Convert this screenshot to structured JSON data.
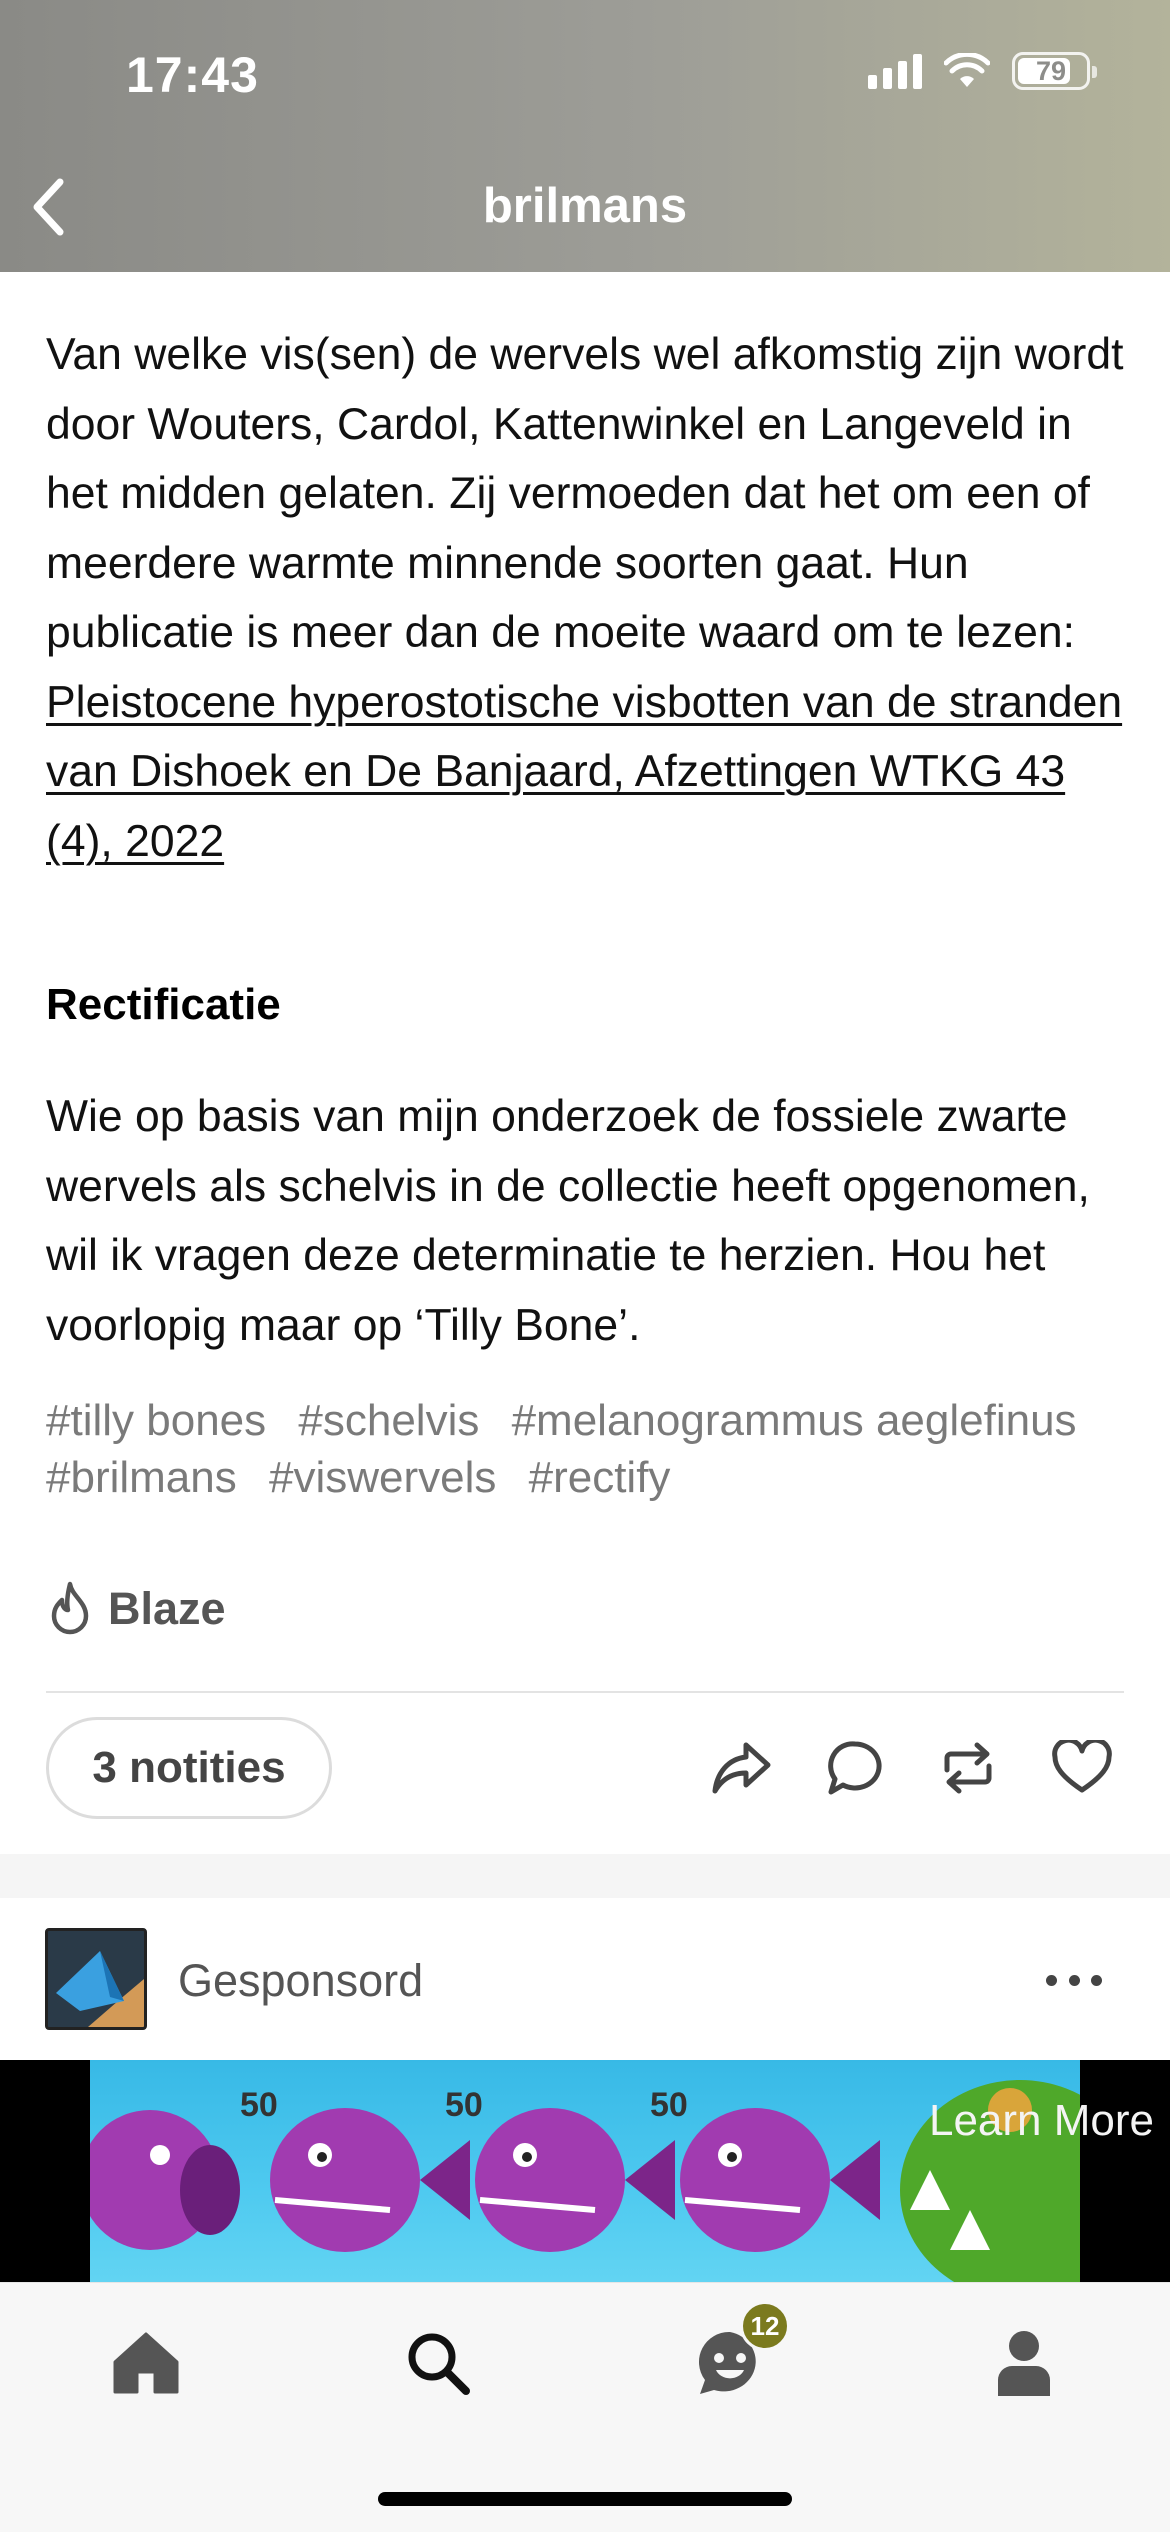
{
  "status_bar": {
    "time": "17:43",
    "battery": "79",
    "battery_level": 0.79
  },
  "header": {
    "title": "brilmans",
    "back_icon": "chevron-left-icon"
  },
  "post": {
    "paragraph1_text": "Van welke vis(sen) de wervels wel afkomstig zijn wordt door Wouters, Cardol, Kattenwinkel en Langeveld in het midden gelaten. Zij vermoeden dat het om een of meerdere warmte minnende soorten gaat. Hun publicatie is meer dan de moeite waard om te lezen:",
    "paragraph1_link": " Pleistocene hyperostotische visbotten van de stranden van Dishoek en De Banjaard, Afzettingen WTKG 43 (4), 2022",
    "heading": "Rectificatie",
    "paragraph2": "Wie op basis van mijn onderzoek de fossiele zwarte wervels als schelvis in de collectie heeft opgenomen, wil ik vragen deze determinatie te herzien. Hou het voorlopig maar op ‘Tilly Bone’.",
    "tags": [
      "#tilly bones",
      "#schelvis",
      "#melanogrammus aeglefinus",
      "#brilmans",
      "#viswervels",
      "#rectify"
    ],
    "blaze_label": "Blaze",
    "notes_label": "3 notities"
  },
  "sponsored": {
    "label": "Gesponsord",
    "cta": "Learn More",
    "ad_numbers": [
      "50",
      "50",
      "50"
    ]
  },
  "tabbar": {
    "notification_count": "12"
  },
  "colors": {
    "header_gradient_start": "#8a8a86",
    "header_gradient_end": "#b3b39b",
    "tag_gray": "#7a7a7a",
    "badge": "#7b7a1e"
  }
}
